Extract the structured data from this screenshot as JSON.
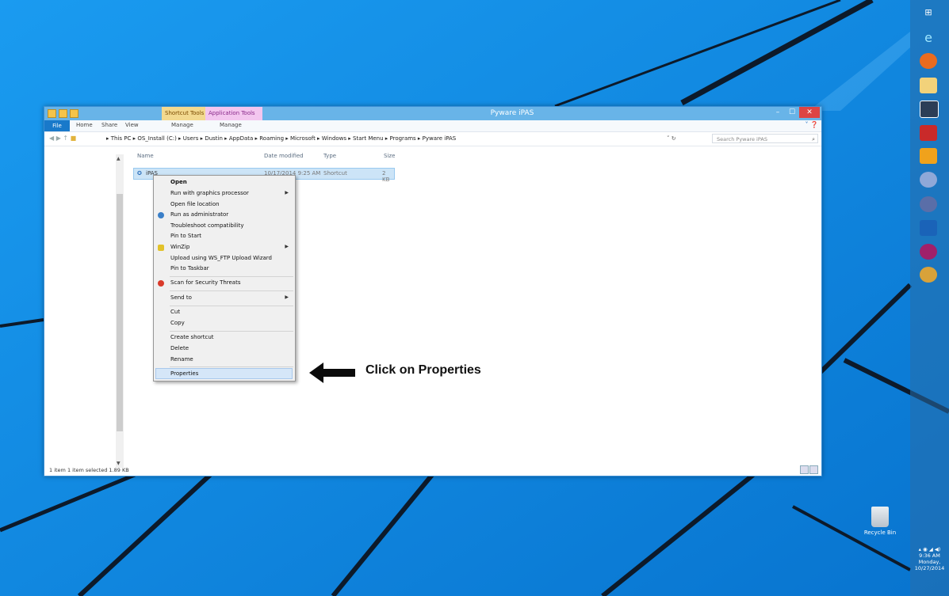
{
  "window": {
    "title": "Pyware iPAS",
    "context_tabs": [
      "Shortcut Tools",
      "Application Tools"
    ],
    "ribbon_tabs": [
      "File",
      "Home",
      "Share",
      "View",
      "Manage",
      "Manage"
    ],
    "minimize": "–",
    "maximize": "☐",
    "close": "✕"
  },
  "address": {
    "crumbs": "▸ This PC ▸ OS_Install (C:) ▸ Users ▸ Dustin ▸ AppData ▸ Roaming ▸ Microsoft ▸ Windows ▸ Start Menu ▸ Programs ▸ Pyware iPAS",
    "search_placeholder": "Search Pyware iPAS"
  },
  "columns": [
    "Name",
    "Date modified",
    "Type",
    "Size"
  ],
  "file": {
    "name": "iPAS",
    "date": "10/17/2014 9:25 AM",
    "type": "Shortcut",
    "size": "2 KB"
  },
  "status": "1 item    1 item selected  1.89 KB",
  "context_menu": [
    {
      "label": "Open",
      "bold": true
    },
    {
      "label": "Run with graphics processor",
      "submenu": true
    },
    {
      "label": "Open file location"
    },
    {
      "label": "Run as administrator",
      "icon": "shield-icon"
    },
    {
      "label": "Troubleshoot compatibility"
    },
    {
      "label": "Pin to Start"
    },
    {
      "label": "WinZip",
      "icon": "winzip-icon",
      "submenu": true
    },
    {
      "label": "Upload using WS_FTP Upload Wizard"
    },
    {
      "label": "Pin to Taskbar"
    },
    {
      "label": "Scan for Security Threats",
      "icon": "security-icon"
    },
    {
      "label": "Send to",
      "submenu": true
    },
    {
      "label": "Cut"
    },
    {
      "label": "Copy"
    },
    {
      "label": "Create shortcut"
    },
    {
      "label": "Delete"
    },
    {
      "label": "Rename"
    },
    {
      "label": "Properties",
      "highlighted": true
    }
  ],
  "annotation": "Click on Properties",
  "desktop": {
    "recycle_bin": "Recycle Bin",
    "clock_time": "9:36 AM",
    "clock_day": "Monday,",
    "clock_date": "10/27/2014"
  },
  "colors": {
    "desktop": "#0a86e0",
    "titlebar": "#68b4e8",
    "file_tab": "#1979ca",
    "selection": "#cce4f7"
  }
}
